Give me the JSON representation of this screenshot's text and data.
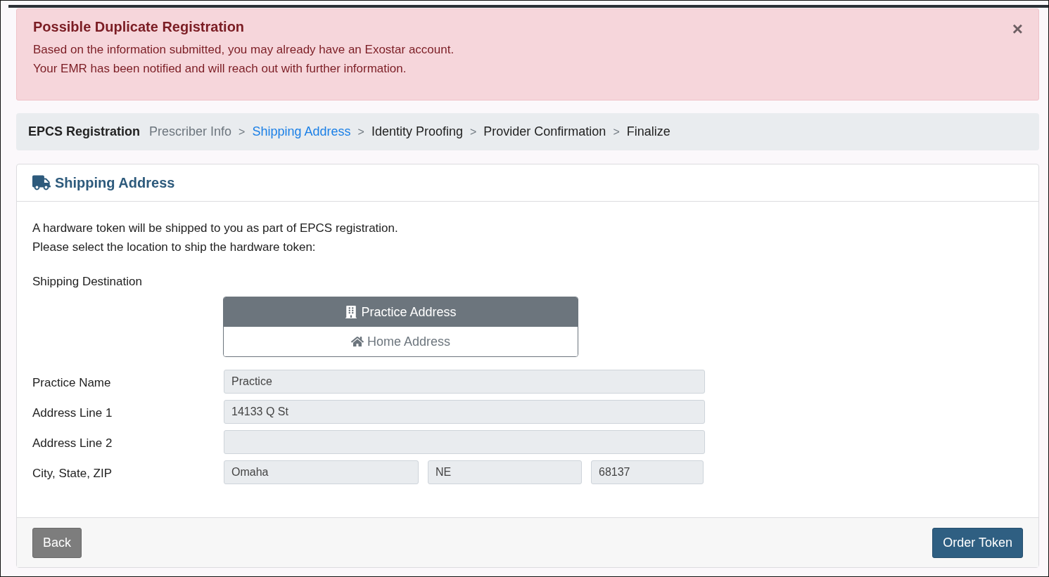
{
  "alert": {
    "title": "Possible Duplicate Registration",
    "lines": [
      "Based on the information submitted, you may already have an Exostar account.",
      "Your EMR has been notified and will reach out with further information."
    ],
    "close": "×"
  },
  "breadcrumb": {
    "title": "EPCS Registration",
    "steps": [
      {
        "label": "Prescriber Info",
        "completed": true,
        "selected": false,
        "separator": ">"
      },
      {
        "label": "Shipping Address",
        "completed": false,
        "selected": true,
        "separator": ">"
      },
      {
        "label": "Identity Proofing",
        "completed": false,
        "selected": false,
        "separator": ">"
      },
      {
        "label": "Provider Confirmation",
        "completed": false,
        "selected": false,
        "separator": ">"
      },
      {
        "label": "Finalize",
        "completed": false,
        "selected": false
      }
    ]
  },
  "card": {
    "title": "Shipping Address",
    "intro": [
      "A hardware token will be shipped to you as part of EPCS registration.",
      "Please select the location to ship the hardware token:"
    ],
    "destination_label": "Shipping Destination",
    "destinations": [
      {
        "label": "Practice Address",
        "kind": "building",
        "selected": true
      },
      {
        "label": "Home Address",
        "kind": "home",
        "selected": false
      }
    ],
    "fields": [
      {
        "label": "Practice Name",
        "kind": "text",
        "value": "Practice"
      },
      {
        "label": "Address Line 1",
        "kind": "text",
        "value": "14133 Q St"
      },
      {
        "label": "Address Line 2",
        "kind": "text"
      },
      {
        "label": "City, State, ZIP",
        "kind": "city_state_zip",
        "values": [
          "Omaha",
          "NE",
          "68137"
        ]
      }
    ],
    "back_button": "Back",
    "submit_button": "Order Token"
  }
}
